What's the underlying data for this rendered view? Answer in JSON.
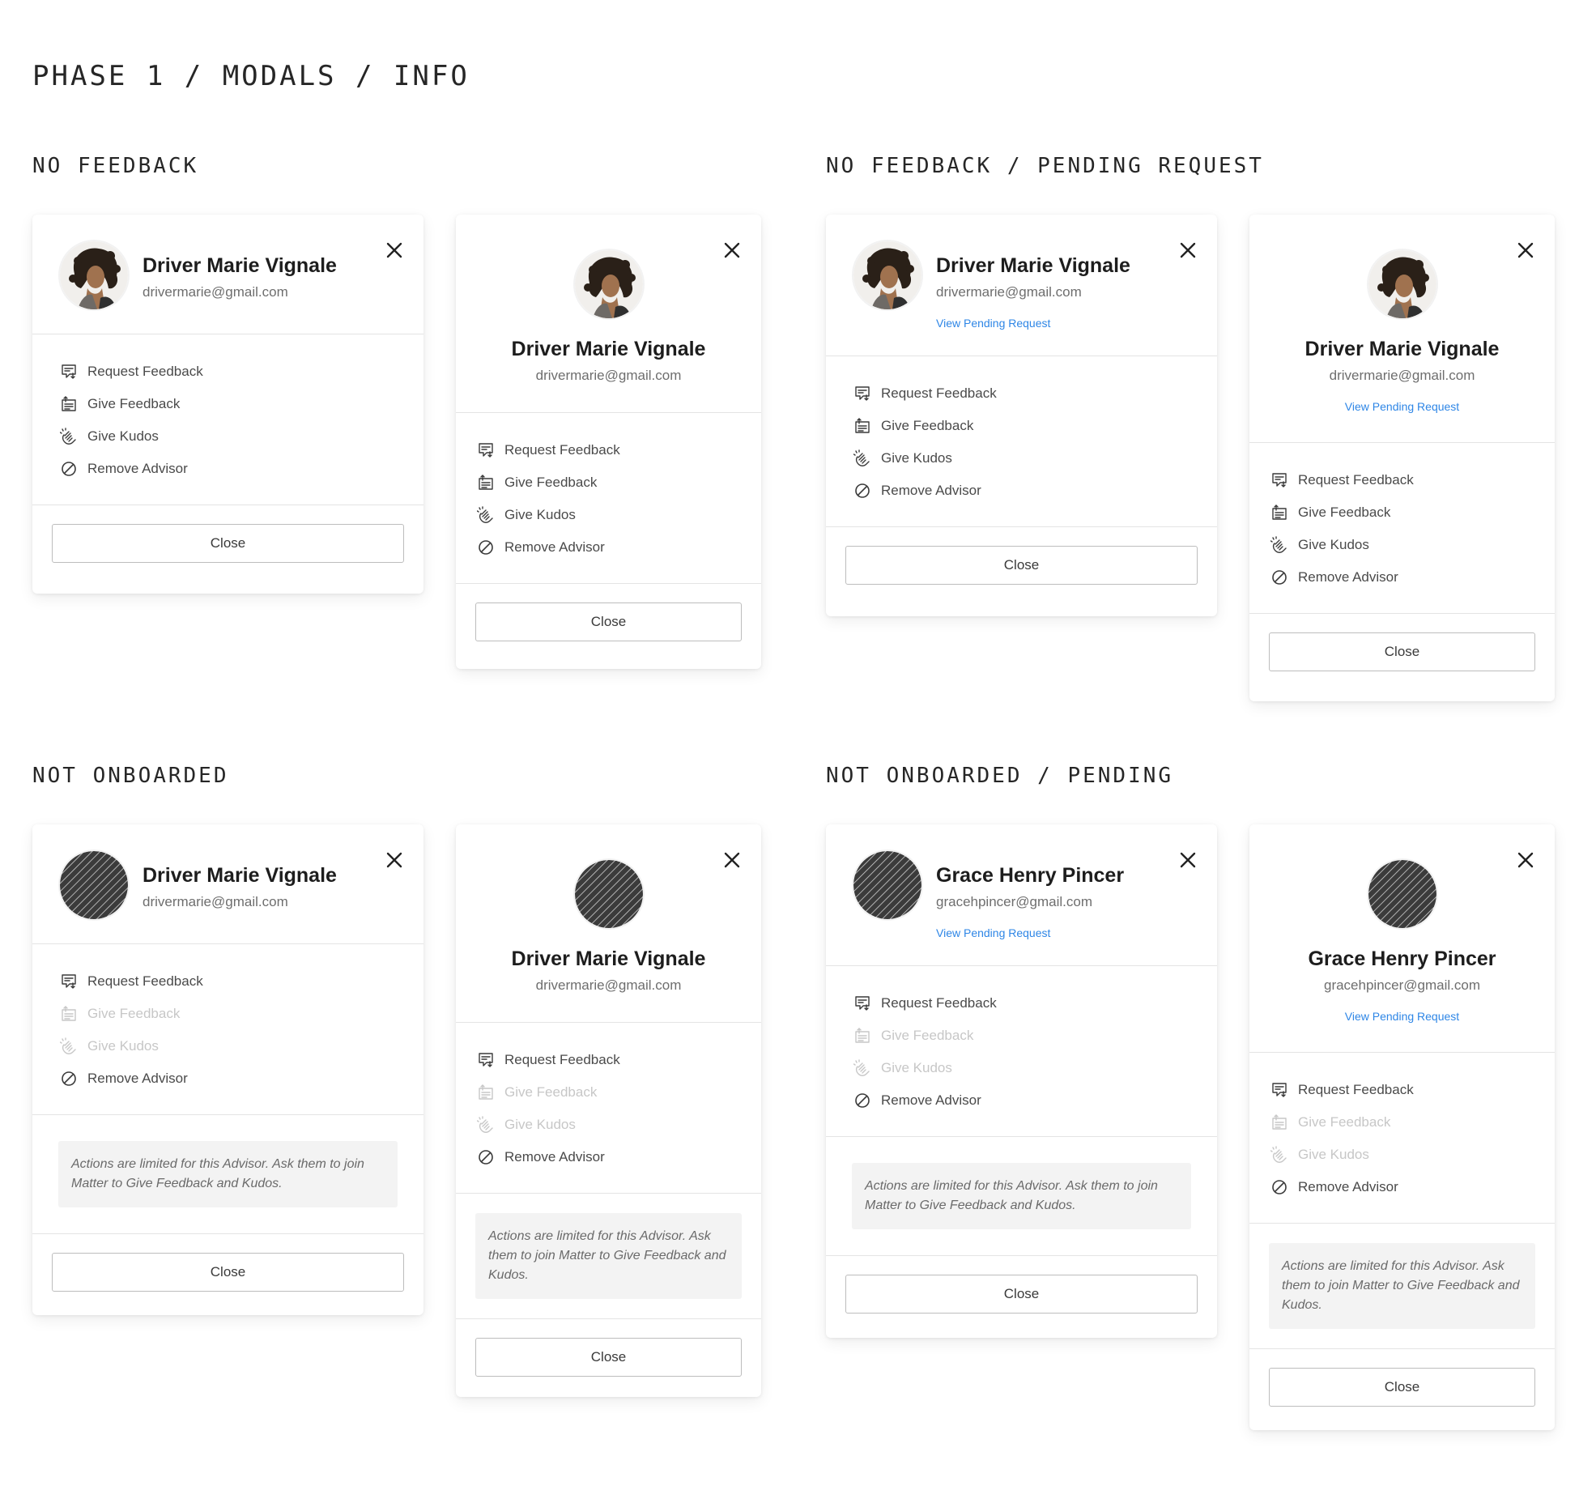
{
  "page_title": "PHASE 1 / MODALS / INFO",
  "sections": {
    "no_feedback": "NO FEEDBACK",
    "no_feedback_pending": "NO FEEDBACK / PENDING REQUEST",
    "not_onboarded": "NOT ONBOARDED",
    "not_onboarded_pending": "NOT ONBOARDED / PENDING"
  },
  "people": {
    "driver": {
      "name": "Driver Marie Vignale",
      "email": "drivermarie@gmail.com"
    },
    "grace": {
      "name": "Grace Henry Pincer",
      "email": "gracehpincer@gmail.com"
    }
  },
  "labels": {
    "view_pending": "View Pending Request",
    "request_feedback": "Request Feedback",
    "give_feedback": "Give Feedback",
    "give_kudos": "Give Kudos",
    "remove_advisor": "Remove Advisor",
    "close": "Close",
    "notice": "Actions are limited for this Advisor. Ask them to join Matter to Give Feedback and Kudos."
  },
  "icons": {
    "close": "close-icon",
    "request_feedback": "request-feedback-icon",
    "give_feedback": "give-feedback-icon",
    "give_kudos": "clap-icon",
    "remove_advisor": "block-icon",
    "avatar_photo": "avatar-photo",
    "avatar_placeholder": "hatched-avatar-placeholder"
  },
  "colors": {
    "link": "#2e86e6",
    "disabled": "#c7c7c7",
    "text": "#4a4a4a"
  }
}
